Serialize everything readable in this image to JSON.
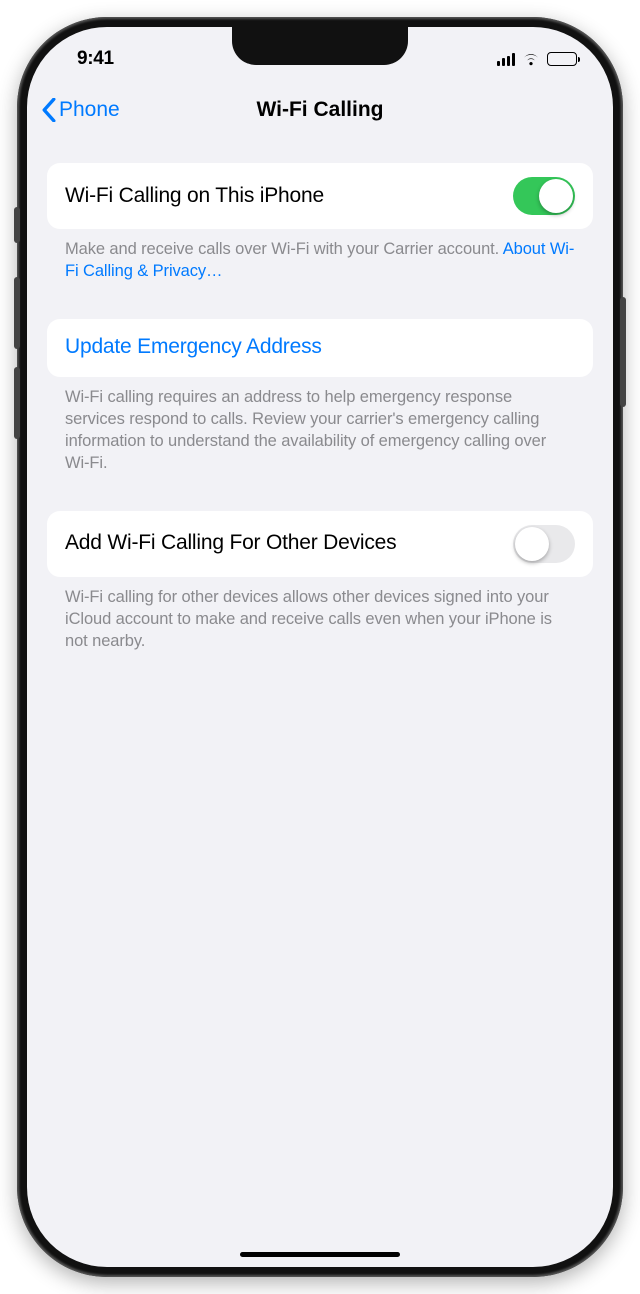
{
  "status": {
    "time": "9:41"
  },
  "nav": {
    "back_label": "Phone",
    "title": "Wi-Fi Calling"
  },
  "s1": {
    "label": "Wi-Fi Calling on This iPhone",
    "on": true,
    "note_pre": "Make and receive calls over Wi-Fi with your Carrier account. ",
    "note_link": "About Wi-Fi Calling & Privacy…"
  },
  "s2": {
    "link_label": "Update Emergency Address",
    "note": "Wi-Fi calling requires an address to help emergency response services respond to calls. Review your carrier's emergency calling information to understand the availability of emergency calling over Wi-Fi."
  },
  "s3": {
    "label": "Add Wi-Fi Calling For Other Devices",
    "on": false,
    "note": "Wi-Fi calling for other devices allows other devices signed into your iCloud account to make and receive calls even when your iPhone is not nearby."
  }
}
